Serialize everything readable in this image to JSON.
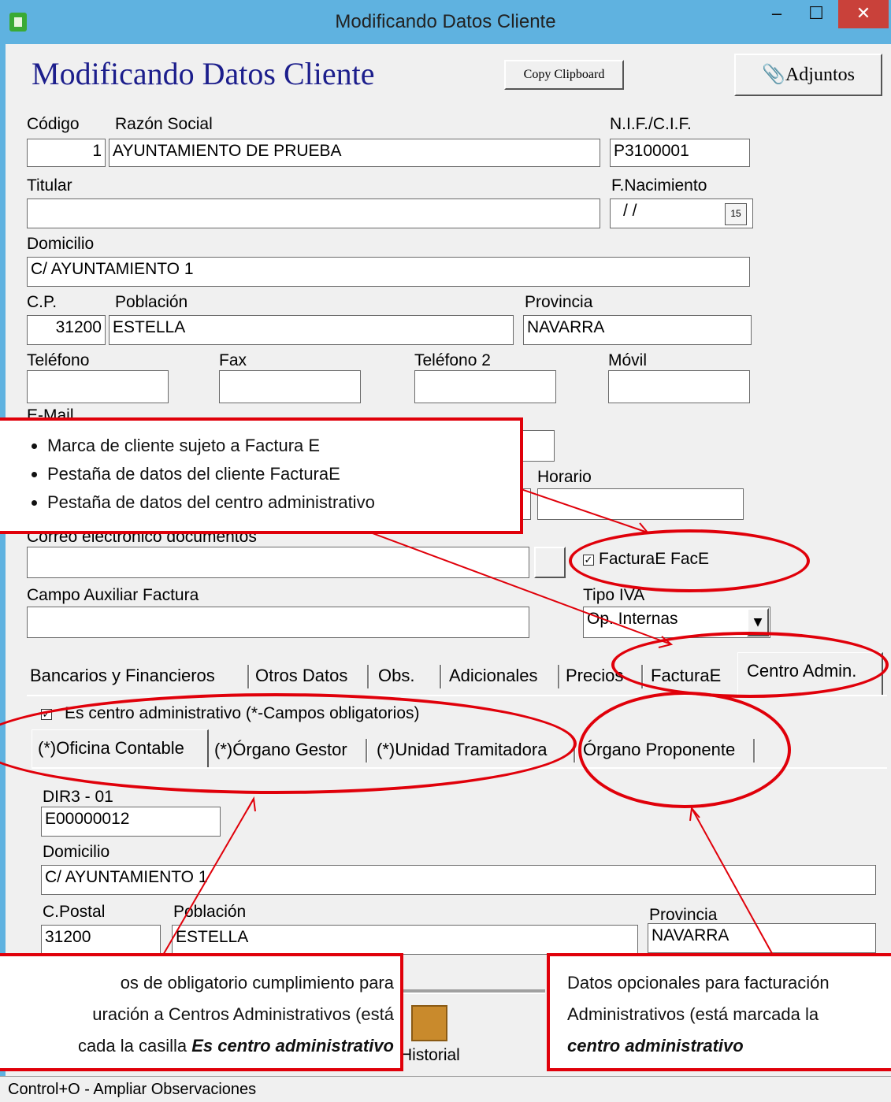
{
  "window": {
    "title": "Modificando Datos Cliente",
    "minimize": "–",
    "maximize": "☐",
    "close": "✕"
  },
  "header": {
    "title": "Modificando Datos Cliente",
    "copy_button": "Copy Clipboard",
    "attach_button": "Adjuntos",
    "attach_icon": "paperclip-icon"
  },
  "form": {
    "codigo_label": "Código",
    "codigo_value": "1",
    "razon_label": "Razón Social",
    "razon_value": "AYUNTAMIENTO DE PRUEBA",
    "nif_label": "N.I.F./C.I.F.",
    "nif_value": "P3100001",
    "titular_label": "Titular",
    "titular_value": "",
    "fnac_label": "F.Nacimiento",
    "fnac_value": "/ /",
    "fnac_icon": "calendar-icon",
    "domicilio_label": "Domicilio",
    "domicilio_value": "C/ AYUNTAMIENTO 1",
    "cp_label": "C.P.",
    "cp_value": "31200",
    "poblacion_label": "Población",
    "poblacion_value": "ESTELLA",
    "provincia_label": "Provincia",
    "provincia_value": "NAVARRA",
    "telefono_label": "Teléfono",
    "fax_label": "Fax",
    "telefono2_label": "Teléfono 2",
    "movil_label": "Móvil",
    "email_label": "E-Mail",
    "horario_label": "Horario",
    "correo_docs_label": "Correo electrónico documentos",
    "facturae_checkbox": "FacturaE FacE",
    "campo_aux_label": "Campo Auxiliar Factura",
    "tipo_iva_label": "Tipo IVA",
    "tipo_iva_value": "Op. Internas"
  },
  "tabs": [
    "Bancarios y Financieros",
    "Otros Datos",
    "Obs.",
    "Adicionales",
    "Precios",
    "FacturaE",
    "Centro Admin."
  ],
  "centro": {
    "checkbox": "Es centro administrativo  (*-Campos obligatorios)",
    "subtabs": [
      "(*)Oficina Contable",
      "(*)Órgano Gestor",
      "(*)Unidad Tramitadora",
      "Órgano Proponente"
    ],
    "dir3_label": "DIR3 - 01",
    "dir3_value": "E00000012",
    "domicilio_label": "Domicilio",
    "domicilio_value": "C/ AYUNTAMIENTO 1",
    "cpostal_label": "C.Postal",
    "cpostal_value": "31200",
    "poblacion_label": "Población",
    "poblacion_value": "ESTELLA",
    "provincia_label": "Provincia",
    "provincia_value": "NAVARRA"
  },
  "toolbar": {
    "historial": "Historial",
    "historial_icon": "cabinet-icon"
  },
  "status": "Control+O - Ampliar Observaciones",
  "callouts": {
    "top_items": [
      "Marca de cliente sujeto a Factura E",
      "Pestaña de datos del cliente FacturaE",
      "Pestaña de datos del centro administrativo"
    ],
    "left_line1": "os de obligatorio cumplimiento para",
    "left_line2": "uración a Centros Administrativos (está",
    "left_line3_pre": "cada la casilla ",
    "left_line3_em": "Es centro administrativo",
    "right_line1": "Datos opcionales para facturación",
    "right_line2": "Administrativos (está marcada la",
    "right_line3_em": "centro administrativo"
  },
  "colors": {
    "titlebar": "#5fb2e0",
    "annotation": "#e0000a",
    "heading": "#1c1e8c",
    "close": "#c9413a"
  }
}
